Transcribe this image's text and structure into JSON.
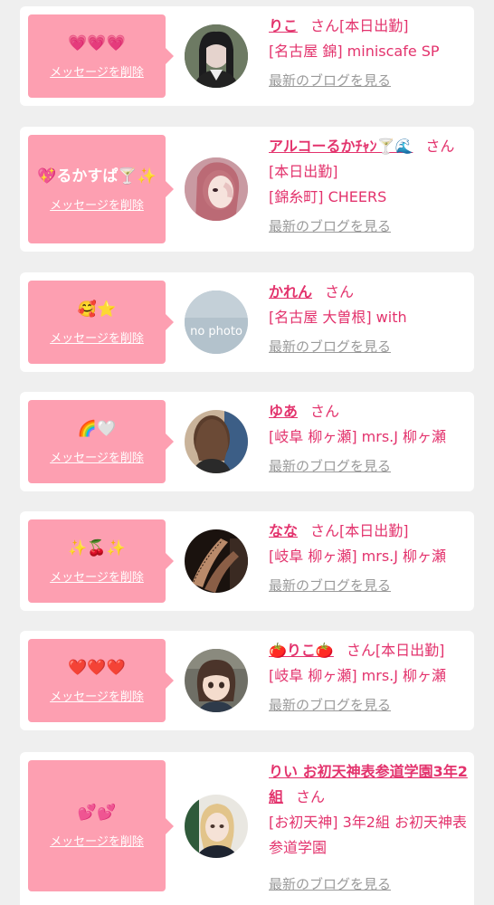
{
  "cards": [
    {
      "emoji": "💗💗💗",
      "delete_label": "メッセージを削除",
      "name": "りこ",
      "san": "さん",
      "status": "[本日出勤]",
      "shop": "[名古屋 錦] miniscafe SP",
      "blog_label": "最新のブログを見る"
    },
    {
      "emoji": "💖るかすぱ🍸✨",
      "delete_label": "メッセージを削除",
      "name": "アルコーるかﾁｬﾝ🍸🌊",
      "san": "さん",
      "status": "[本日出勤]",
      "shop": "[錦糸町] CHEERS",
      "blog_label": "最新のブログを見る"
    },
    {
      "emoji": "🥰⭐",
      "delete_label": "メッセージを削除",
      "name": "かれん",
      "san": "さん",
      "status": "",
      "shop": "[名古屋 大曽根] with",
      "avatar_text": "no photo",
      "blog_label": "最新のブログを見る"
    },
    {
      "emoji": "🌈🤍",
      "delete_label": "メッセージを削除",
      "name": "ゆあ",
      "san": "さん",
      "status": "",
      "shop": "[岐阜 柳ヶ瀬] mrs.J 柳ヶ瀬",
      "blog_label": "最新のブログを見る"
    },
    {
      "emoji": "✨🍒✨",
      "delete_label": "メッセージを削除",
      "name": "なな",
      "san": "さん",
      "status": "[本日出勤]",
      "shop": "[岐阜 柳ヶ瀬] mrs.J 柳ヶ瀬",
      "blog_label": "最新のブログを見る"
    },
    {
      "emoji": "❤️❤️❤️",
      "delete_label": "メッセージを削除",
      "name": "🍅りこ🍅",
      "san": "さん",
      "status": "[本日出勤]",
      "shop": "[岐阜 柳ヶ瀬] mrs.J 柳ヶ瀬",
      "blog_label": "最新のブログを見る"
    },
    {
      "emoji": "💕💕",
      "delete_label": "メッセージを削除",
      "name": "りい お初天神表参道学園3年2組",
      "san": "さん",
      "status": "",
      "shop": "[お初天神] 3年2組 お初天神表参道学園",
      "blog_label": "最新のブログを見る"
    }
  ]
}
